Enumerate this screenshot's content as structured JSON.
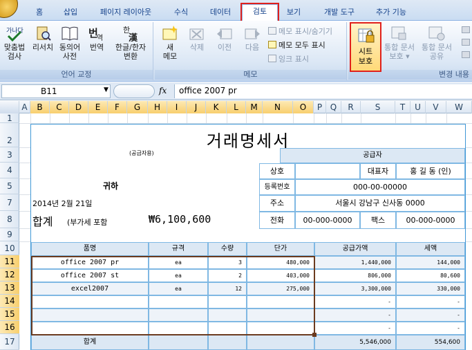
{
  "ribbon_tabs": [
    {
      "label": "홈"
    },
    {
      "label": "삽입"
    },
    {
      "label": "페이지 레이아웃"
    },
    {
      "label": "수식"
    },
    {
      "label": "데이터"
    },
    {
      "label": "검토",
      "active": true
    },
    {
      "label": "보기"
    },
    {
      "label": "개발 도구"
    },
    {
      "label": "추가 기능"
    }
  ],
  "groups": {
    "proofing": {
      "title": "언어 교정",
      "buttons": [
        {
          "line1": "맞춤법",
          "line2": "검사"
        },
        {
          "line1": "리서치",
          "line2": ""
        },
        {
          "line1": "동의어",
          "line2": "사전"
        },
        {
          "line1": "번역",
          "line2": ""
        },
        {
          "line1": "한글/한자",
          "line2": "변환"
        }
      ]
    },
    "comments": {
      "title": "메모",
      "big": [
        {
          "line1": "새",
          "line2": "메모"
        },
        {
          "line1": "삭제",
          "line2": ""
        },
        {
          "line1": "이전",
          "line2": ""
        },
        {
          "line1": "다음",
          "line2": ""
        }
      ],
      "small": [
        "메모 표시/숨기기",
        "메모 모두 표시",
        "잉크 표시"
      ]
    },
    "changes": {
      "title": "변경 내용",
      "buttons": [
        {
          "line1": "시트",
          "line2": "보호"
        },
        {
          "line1": "통합 문서",
          "line2": "보호 ▾"
        },
        {
          "line1": "통합 문서",
          "line2": "공유"
        }
      ]
    }
  },
  "formula_bar": {
    "name_box": "B11",
    "fx": "fx",
    "formula": "office 2007 pr"
  },
  "columns": [
    "A",
    "B",
    "C",
    "D",
    "E",
    "F",
    "G",
    "H",
    "I",
    "J",
    "K",
    "L",
    "M",
    "N",
    "O",
    "P",
    "Q",
    "R",
    "S",
    "T",
    "U",
    "V",
    "W"
  ],
  "rows": [
    "1",
    "2",
    "3",
    "4",
    "5",
    "7",
    "8",
    "9",
    "10",
    "11",
    "12",
    "13",
    "14",
    "15",
    "16",
    "17"
  ],
  "invoice": {
    "title": "거래명세서",
    "receiver_tag": "(공급자용)",
    "supplier_header": "공급자",
    "recipient": "귀하",
    "date": "2014년 2월 21일",
    "total_label": "합계",
    "vat_note": "(부가세 포함",
    "total_amount": "₩6,100,600",
    "supplier": {
      "name_label": "상호",
      "name": "",
      "ceo_label": "대표자",
      "ceo": "홍 길 동  (인)",
      "reg_label": "등록번호",
      "reg": "000-00-00000",
      "addr_label": "주소",
      "addr": "서울시 강남구 신사동 0000",
      "tel_label": "전화",
      "tel": "00-000-0000",
      "fax_label": "팩스",
      "fax": "00-000-0000"
    },
    "table_headers": [
      "품명",
      "규격",
      "수량",
      "단가",
      "공급가액",
      "세액"
    ],
    "items": [
      {
        "name": "office 2007 pr",
        "spec": "ea",
        "qty": "3",
        "price": "480,000",
        "supply": "1,440,000",
        "tax": "144,000"
      },
      {
        "name": "office 2007 st",
        "spec": "ea",
        "qty": "2",
        "price": "403,000",
        "supply": "806,000",
        "tax": "80,600"
      },
      {
        "name": "excel2007",
        "spec": "ea",
        "qty": "12",
        "price": "275,000",
        "supply": "3,300,000",
        "tax": "330,000"
      },
      {
        "name": "",
        "spec": "",
        "qty": "",
        "price": "",
        "supply": "-",
        "tax": "-"
      },
      {
        "name": "",
        "spec": "",
        "qty": "",
        "price": "",
        "supply": "-",
        "tax": "-"
      },
      {
        "name": "",
        "spec": "",
        "qty": "",
        "price": "",
        "supply": "-",
        "tax": "-"
      }
    ],
    "sum_label": "합계",
    "sum_supply": "5,546,000",
    "sum_tax": "554,600"
  },
  "colors": {
    "accent_red": "#e0201c",
    "form_border": "#3f97d6",
    "header_fill": "#dce8f4"
  }
}
